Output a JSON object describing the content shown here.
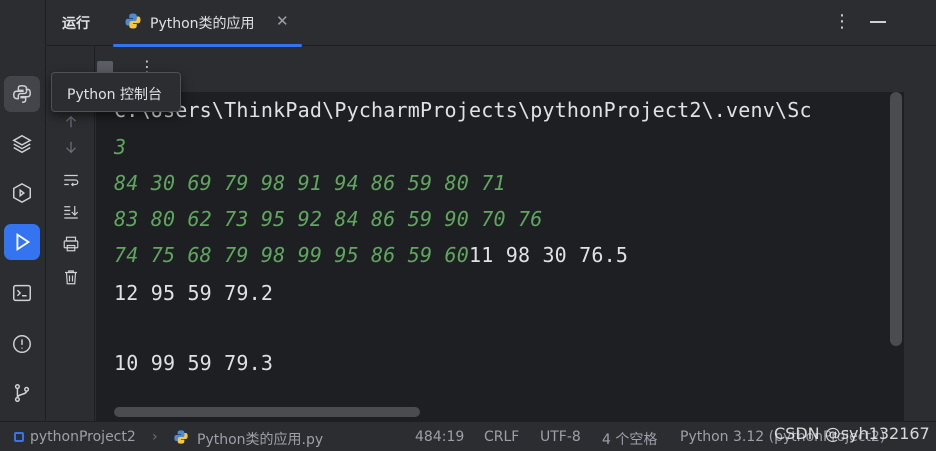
{
  "header": {
    "title": "运行",
    "tab_label": "Python类的应用",
    "tab_close": "✕",
    "more": "⋮"
  },
  "tooltip": {
    "text": "Python 控制台"
  },
  "console": {
    "lines": [
      {
        "text": "C:\\Users\\ThinkPad\\PycharmProjects\\pythonProject2\\.venv\\Sc",
        "kind": "out"
      },
      {
        "text": "3",
        "kind": "in"
      },
      {
        "text": "84 30 69 79 98 91 94 86 59 80 71",
        "kind": "in"
      },
      {
        "text": "83 80 62 73 95 92 84 86 59 90 70 76",
        "kind": "in"
      },
      {
        "in_part": "74 75 68 79 98 99 95 86 59 60",
        "out_part": "11 98 30 76.5"
      },
      {
        "text": "12 95 59 79.2",
        "kind": "out"
      },
      {
        "text": "",
        "kind": "out"
      },
      {
        "text": "10 99 59 79.3",
        "kind": "out"
      }
    ]
  },
  "statusbar": {
    "project": "pythonProject2",
    "file": "Python类的应用.py",
    "position": "484:19",
    "line_sep": "CRLF",
    "encoding": "UTF-8",
    "indent": "4 个空格",
    "interpreter": "Python 3.12 (pythonProject2)"
  },
  "watermark": "CSDN @syh132167",
  "colors": {
    "accent": "#3574f0",
    "input_text": "#5fa65f",
    "output_text": "#dfe1e5",
    "console_bg": "#1e1f22",
    "panel_bg": "#2b2d30"
  },
  "icons": {
    "activity": [
      "python-console-icon",
      "layers-icon",
      "debug-icon",
      "run-icon",
      "terminal-icon",
      "problems-icon",
      "git-branch-icon"
    ],
    "toolbar": [
      "rerun-icon",
      "stop-icon",
      "more-options-icon",
      "scroll-up-icon",
      "scroll-down-icon",
      "soft-wrap-icon",
      "scroll-to-end-icon",
      "print-icon",
      "delete-icon"
    ]
  }
}
